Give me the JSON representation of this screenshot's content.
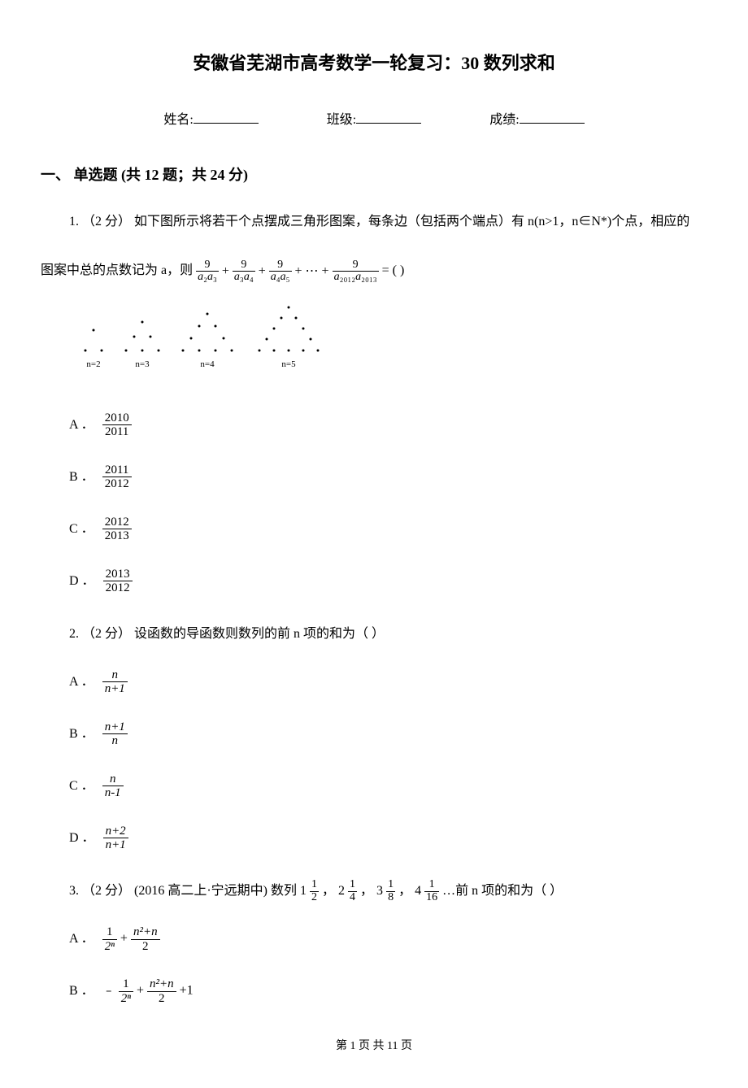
{
  "title": "安徽省芜湖市高考数学一轮复习：30 数列求和",
  "info": {
    "name_label": "姓名:",
    "class_label": "班级:",
    "score_label": "成绩:"
  },
  "section1": {
    "header": "一、 单选题 (共 12 题；共 24 分)"
  },
  "q1": {
    "num": "1.",
    "points": "（2 分）",
    "text_a": "如下图所示将若干个点摆成三角形图案，每条边（包括两个端点）有 n(n>1，n∈N*)个点，相应的",
    "text_b": "图案中总的点数记为 a，则",
    "eq_eq": "= ( )",
    "diag_labels": {
      "n2": "n=2",
      "n3": "n=3",
      "n4": "n=4",
      "n5": "n=5"
    },
    "optA_label": "A ．",
    "optA_num": "2010",
    "optA_den": "2011",
    "optB_label": "B ．",
    "optB_num": "2011",
    "optB_den": "2012",
    "optC_label": "C ．",
    "optC_num": "2012",
    "optC_den": "2013",
    "optD_label": "D ．",
    "optD_num": "2013",
    "optD_den": "2012"
  },
  "q2": {
    "num": "2.",
    "points": "（2 分）",
    "text": "设函数的导函数则数列的前 n 项的和为（    ）",
    "optA_label": "A ．",
    "optA_num": "n",
    "optA_den": "n+1",
    "optB_label": "B ．",
    "optB_num": "n+1",
    "optB_den": "n",
    "optC_label": "C ．",
    "optC_num": "n",
    "optC_den": "n-1",
    "optD_label": "D ．",
    "optD_num": "n+2",
    "optD_den": "n+1"
  },
  "q3": {
    "num": "3.",
    "points": "（2 分）",
    "source": "(2016 高二上·宁远期中)",
    "text_a": "数列 1",
    "t1n": "1",
    "t1d": "2",
    "comma1": " ， 2 ",
    "t2n": "1",
    "t2d": "4",
    "comma2": " ， 3 ",
    "t3n": "1",
    "t3d": "8",
    "comma3": " ， 4 ",
    "t4n": "1",
    "t4d": "16",
    "tail": " …前 n 项的和为（    ）",
    "optA_label": "A ．",
    "optA_f1n": "1",
    "optA_f1d": "2ⁿ",
    "optA_plus": " + ",
    "optA_f2n": "n²+n",
    "optA_f2d": "2",
    "optB_label": "B ．",
    "optB_prefix": "﹣ ",
    "optB_f1n": "1",
    "optB_f1d": "2ⁿ",
    "optB_plus": " + ",
    "optB_f2n": "n²+n",
    "optB_f2d": "2",
    "optB_suffix": " +1"
  },
  "footer": "第 1 页 共 11 页"
}
